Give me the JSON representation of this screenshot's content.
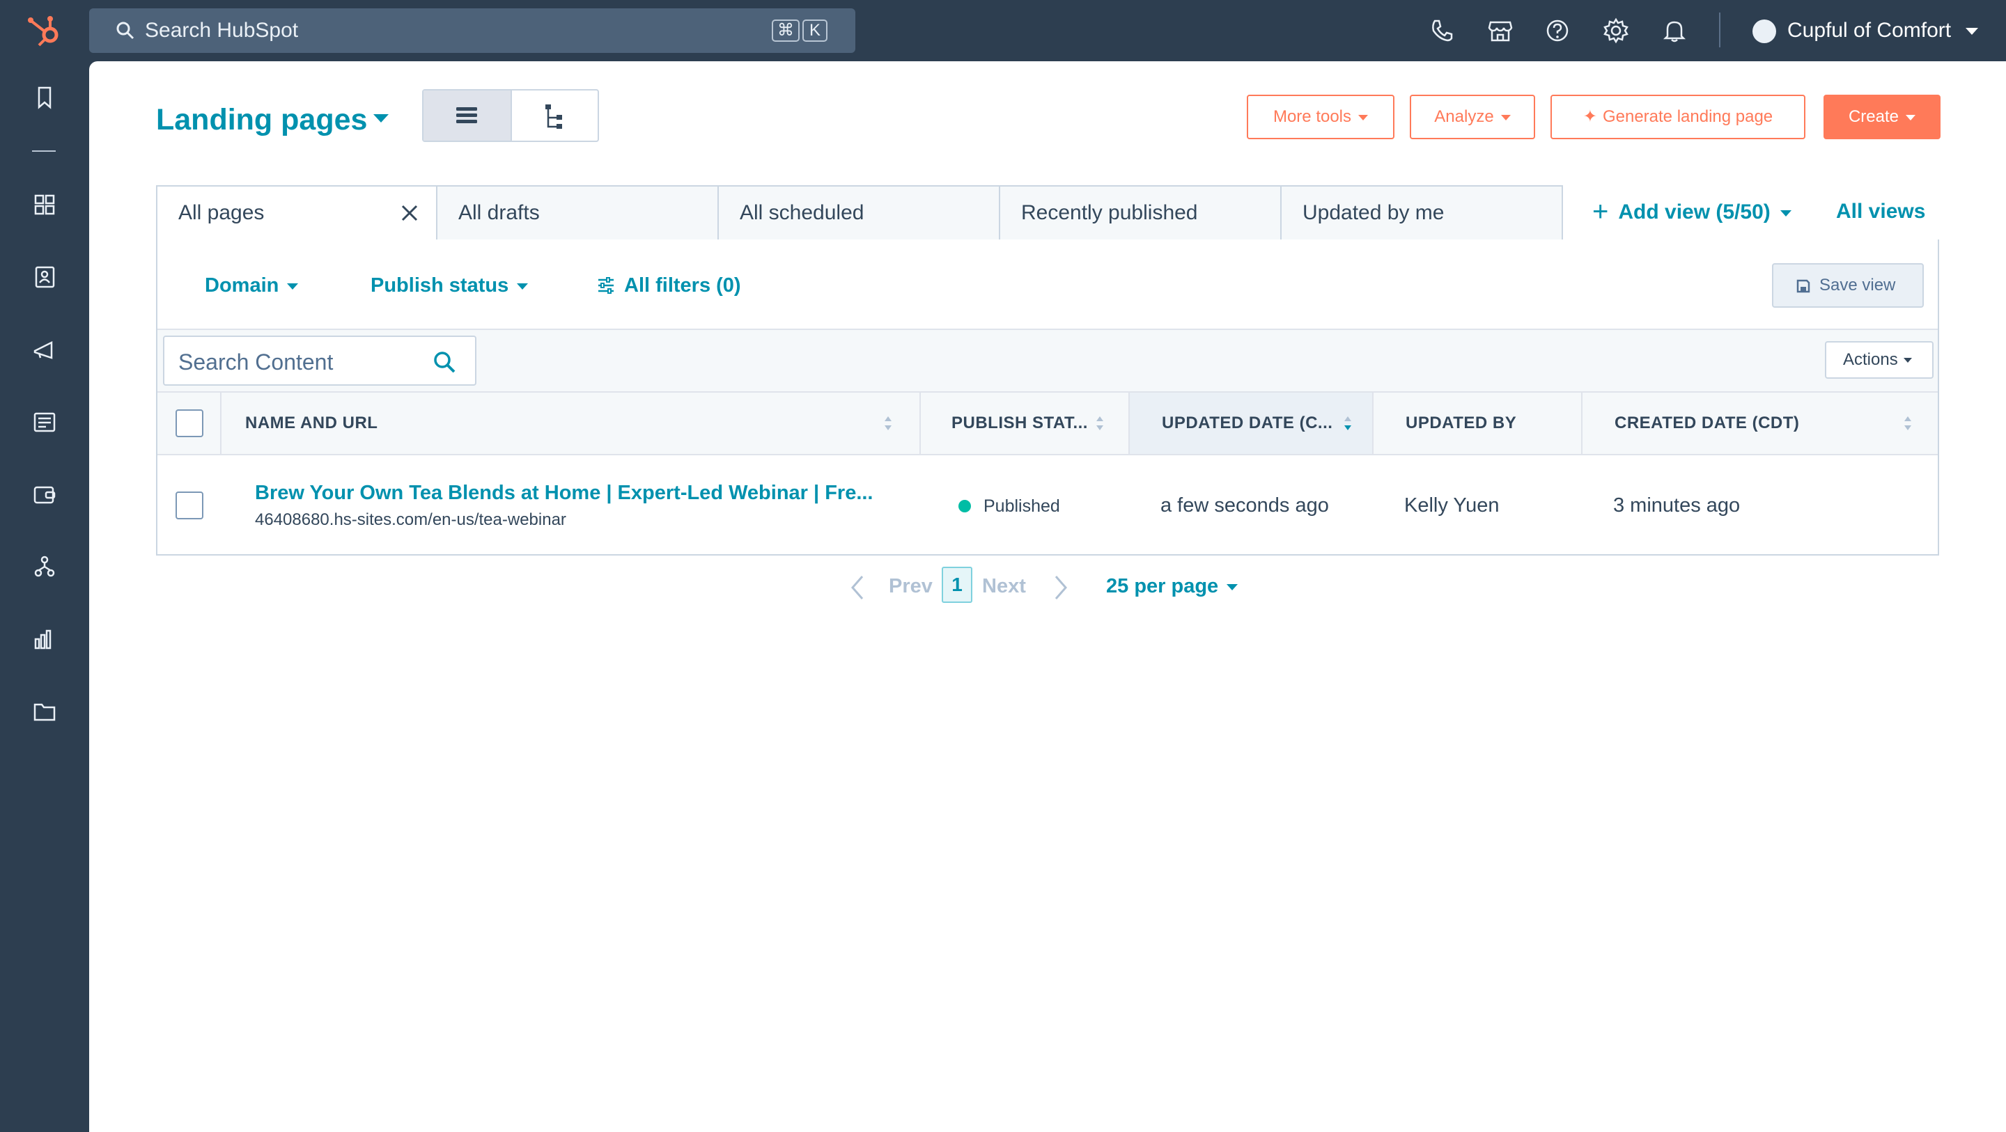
{
  "colors": {
    "nav_bg": "#2d3e50",
    "accent": "#ff7a59",
    "link": "#0091ae",
    "published": "#00bda5"
  },
  "topbar": {
    "search_placeholder": "Search HubSpot",
    "shortcut_cmd": "⌘",
    "shortcut_key": "K",
    "icons": [
      "phone-icon",
      "marketplace-icon",
      "help-icon",
      "settings-icon",
      "notifications-icon"
    ],
    "account_name": "Cupful of Comfort"
  },
  "sidebar": {
    "icons": [
      "bookmark-icon",
      "dashboard-icon",
      "contacts-icon",
      "marketing-icon",
      "content-icon",
      "commerce-icon",
      "automation-icon",
      "reporting-icon",
      "library-icon"
    ]
  },
  "header": {
    "title": "Landing pages",
    "more_tools": "More tools",
    "analyze": "Analyze",
    "generate": "Generate landing page",
    "create": "Create"
  },
  "tabs": [
    "All pages",
    "All drafts",
    "All scheduled",
    "Recently published",
    "Updated by me"
  ],
  "views": {
    "add_view": "Add view (5/50)",
    "all_views": "All views"
  },
  "filters": {
    "domain": "Domain",
    "publish_status": "Publish status",
    "all_filters": "All filters (0)",
    "save_view": "Save view"
  },
  "toolbar": {
    "search_placeholder": "Search Content",
    "actions": "Actions"
  },
  "table": {
    "columns": [
      "NAME AND URL",
      "PUBLISH STAT...",
      "UPDATED DATE (C...",
      "UPDATED BY",
      "CREATED DATE (CDT)"
    ],
    "rows": [
      {
        "name": "Brew Your Own Tea Blends at Home | Expert-Led Webinar | Fre...",
        "url": "46408680.hs-sites.com/en-us/tea-webinar",
        "status": "Published",
        "updated_date": "a few seconds ago",
        "updated_by": "Kelly Yuen",
        "created_date": "3 minutes ago"
      }
    ]
  },
  "pagination": {
    "prev": "Prev",
    "page": "1",
    "next": "Next",
    "per_page": "25 per page"
  }
}
